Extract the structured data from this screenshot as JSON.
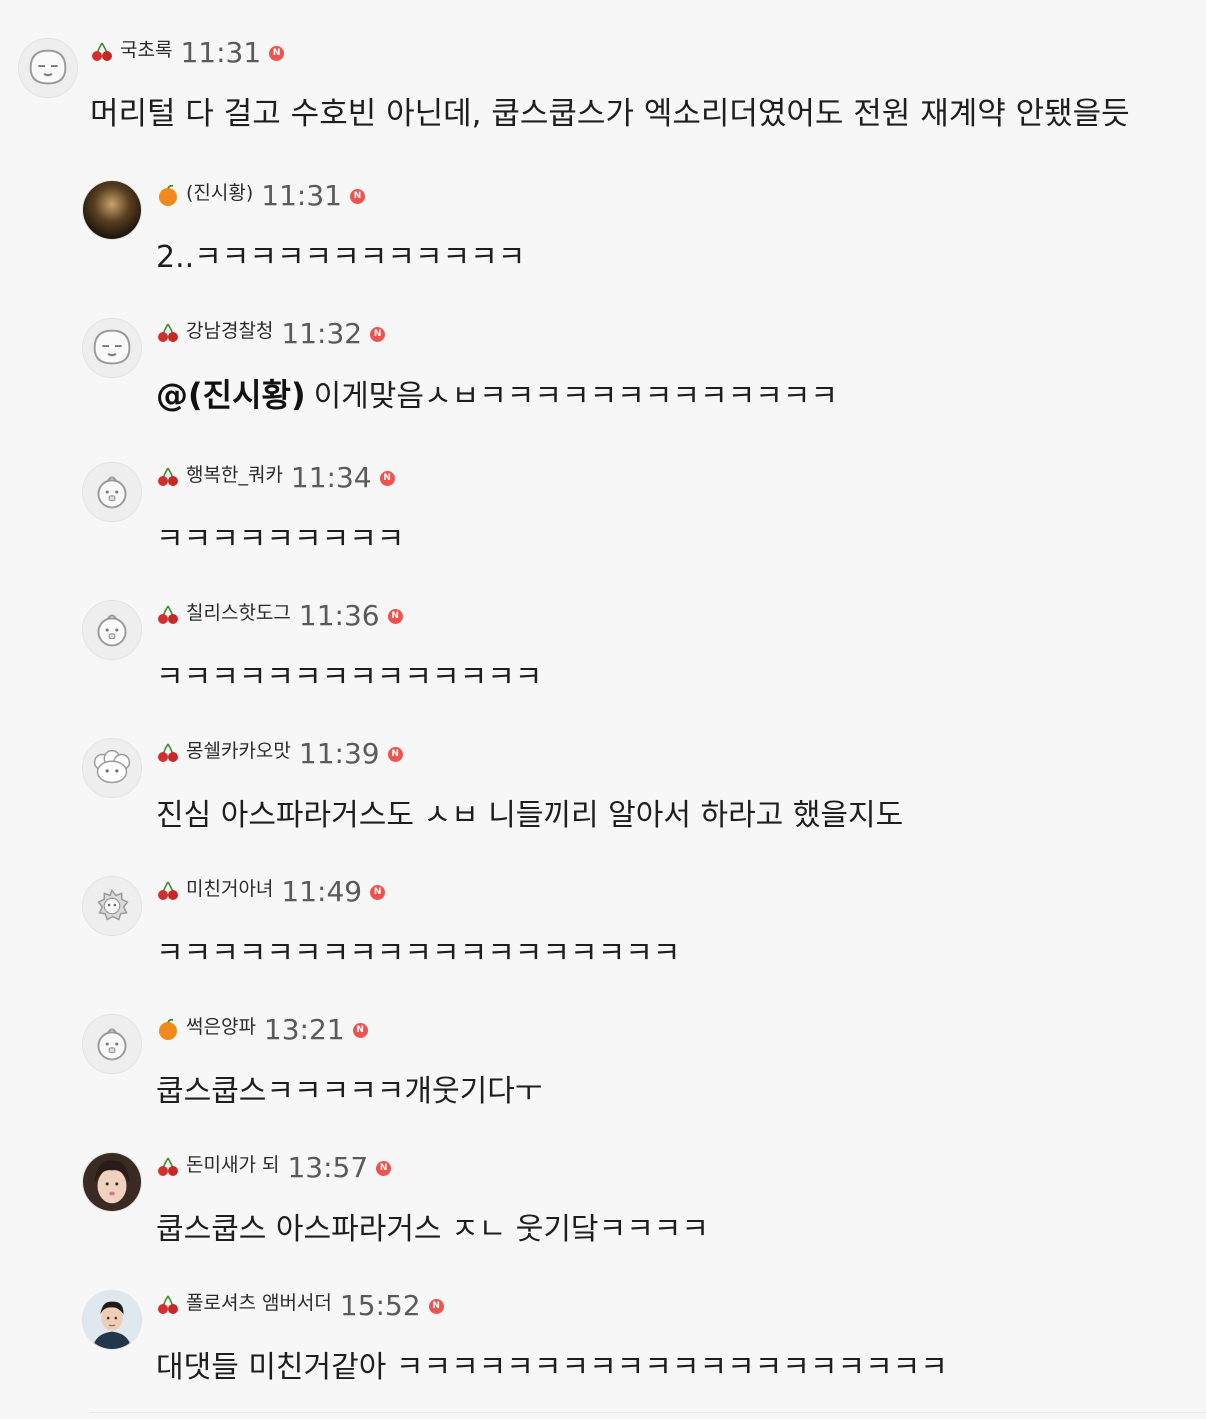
{
  "comments": [
    {
      "nick": "국초록",
      "time": "11:31",
      "badge": "cherry",
      "avatar": "default-avatar",
      "body": "머리털 다 걸고 수호빈 아닌데, 쿱스쿱스가 엑소리더였어도 전원 재계약 안됐을듯"
    },
    {
      "nick": "(진시황)",
      "time": "11:31",
      "badge": "orange",
      "avatar": "photo-avatar-dark",
      "body": "2..ㅋㅋㅋㅋㅋㅋㅋㅋㅋㅋㅋㅋ"
    },
    {
      "nick": "강남경찰청",
      "time": "11:32",
      "badge": "cherry",
      "avatar": "default-avatar",
      "mention": "@(진시황)",
      "body": "이게맞음ㅅㅂㅋㅋㅋㅋㅋㅋㅋㅋㅋㅋㅋㅋㅋ"
    },
    {
      "nick": "행복한_쿼카",
      "time": "11:34",
      "badge": "cherry",
      "avatar": "default-avatar",
      "body": "ㅋㅋㅋㅋㅋㅋㅋㅋㅋ"
    },
    {
      "nick": "칠리스핫도그",
      "time": "11:36",
      "badge": "cherry",
      "avatar": "default-avatar",
      "body": "ㅋㅋㅋㅋㅋㅋㅋㅋㅋㅋㅋㅋㅋㅋ"
    },
    {
      "nick": "몽쉘카카오맛",
      "time": "11:39",
      "badge": "cherry",
      "avatar": "sheep-avatar",
      "body": "진심 아스파라거스도 ㅅㅂ 니들끼리 알아서 하라고 했을지도"
    },
    {
      "nick": "미친거아녀",
      "time": "11:49",
      "badge": "cherry",
      "avatar": "lion-avatar",
      "body": "ㅋㅋㅋㅋㅋㅋㅋㅋㅋㅋㅋㅋㅋㅋㅋㅋㅋㅋㅋ"
    },
    {
      "nick": "썩은양파",
      "time": "13:21",
      "badge": "orange",
      "avatar": "default-avatar",
      "body": "쿱스쿱스ㅋㅋㅋㅋㅋ개웃기다ㅜ"
    },
    {
      "nick": "돈미새가 되",
      "time": "13:57",
      "badge": "cherry",
      "avatar": "photo-avatar-girl",
      "body": "쿱스쿱스 아스파라거스 ㅈㄴ 웃기닼ㅋㅋㅋㅋ"
    },
    {
      "nick": "폴로셔츠 앰버서더",
      "time": "15:52",
      "badge": "cherry",
      "avatar": "photo-avatar-man",
      "body": "대댓들 미친거같아 ㅋㅋㅋㅋㅋㅋㅋㅋㅋㅋㅋㅋㅋㅋㅋㅋㅋㅋㅋㅋ"
    }
  ],
  "new_label": "N",
  "colors": {
    "new_badge": "#ef5350",
    "background": "#f7f7f7"
  }
}
